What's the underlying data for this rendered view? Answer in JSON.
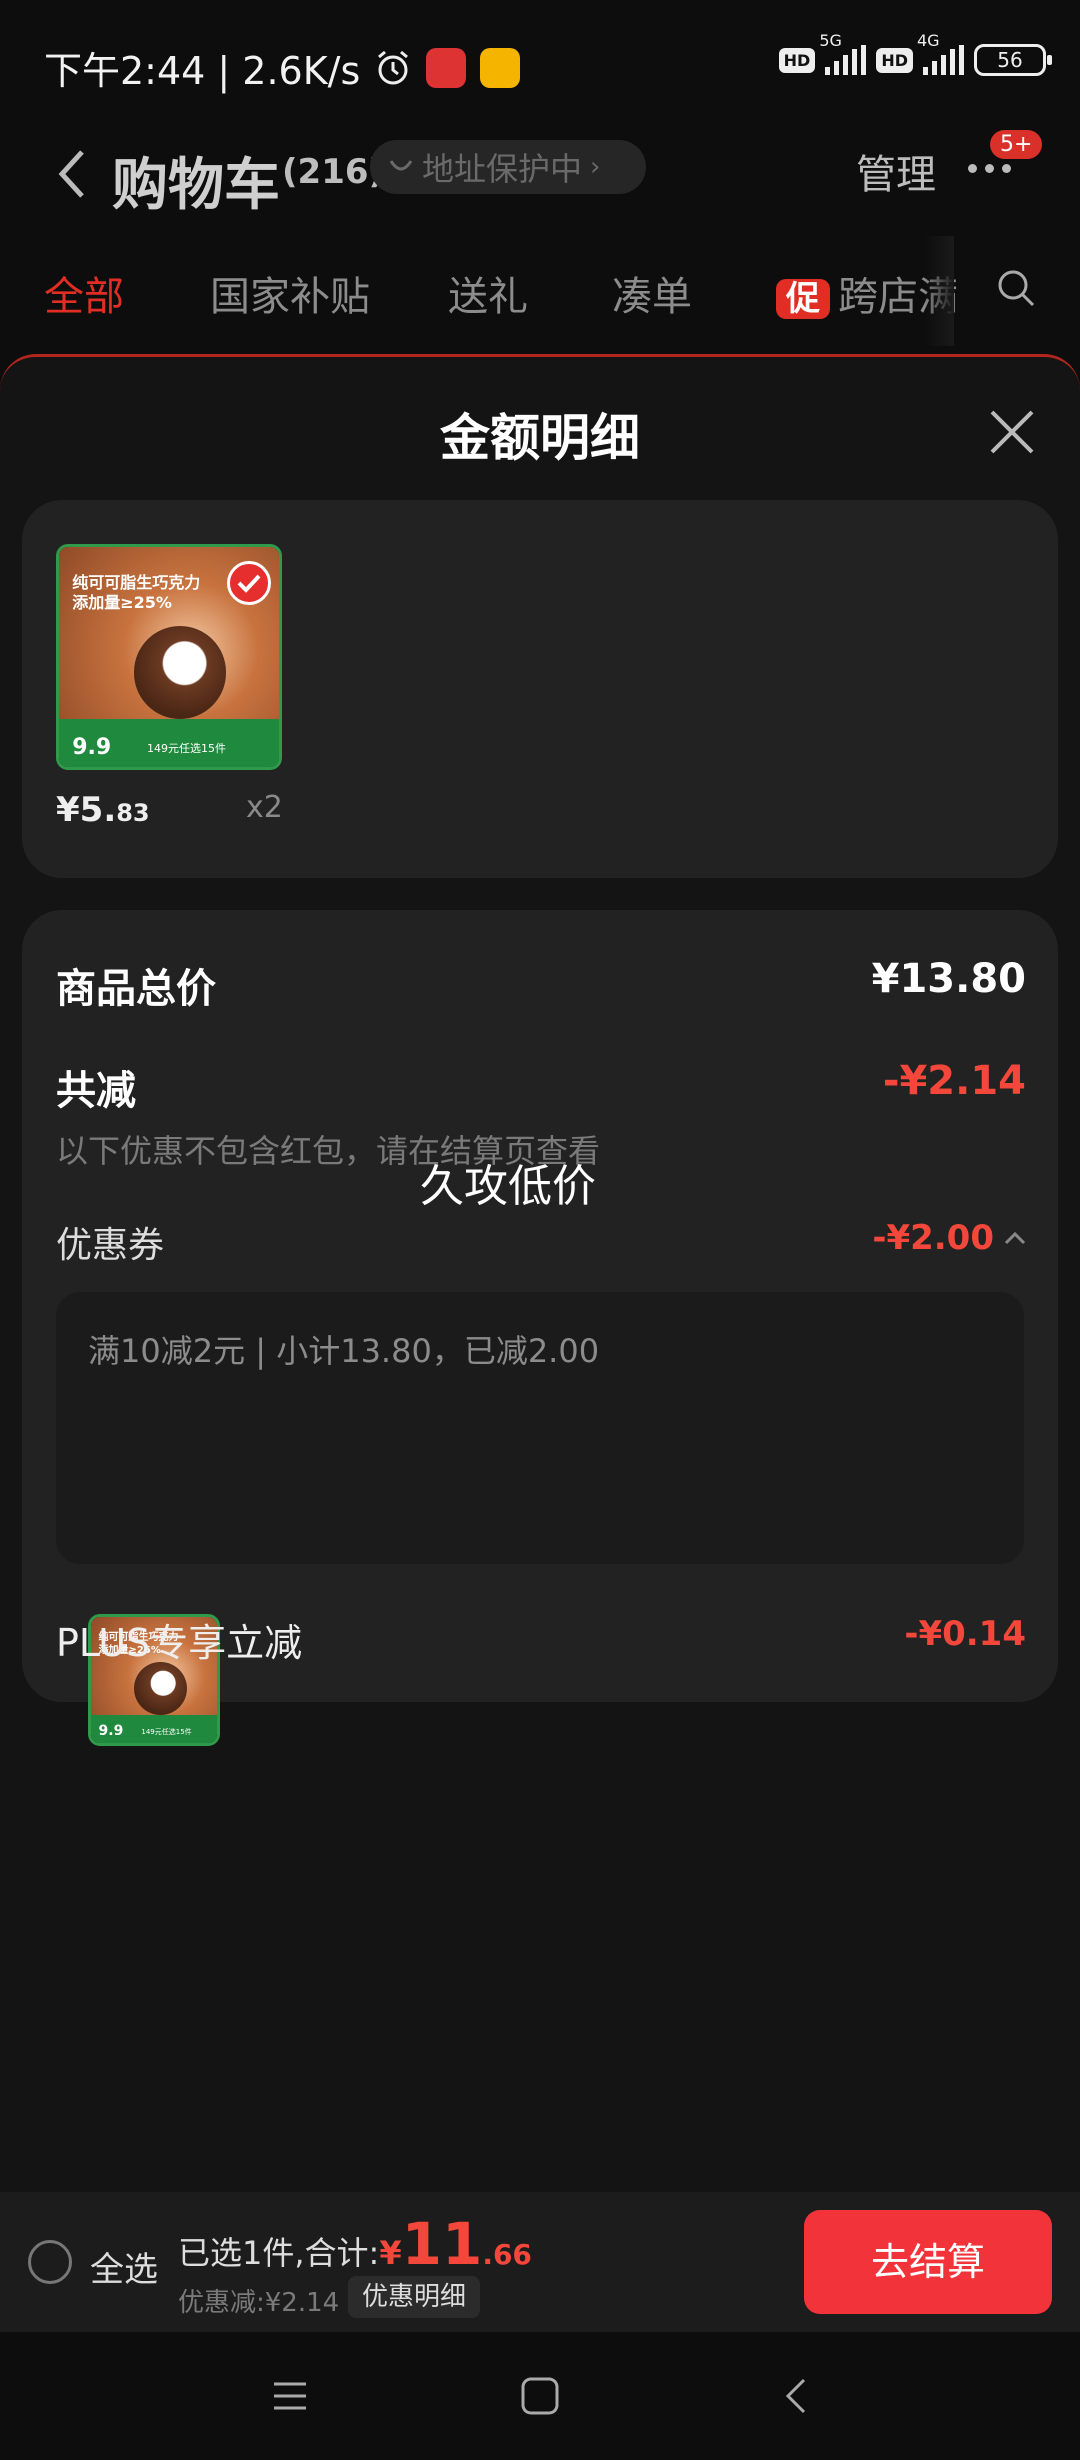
{
  "status_bar": {
    "time_speed": "下午2:44 | 2.6K/s",
    "net1": "5G",
    "net2": "4G",
    "hd": "HD",
    "battery": "56"
  },
  "header": {
    "title": "购物车",
    "count": "(216)",
    "address": "地址保护中",
    "manage": "管理",
    "badge": "5+"
  },
  "tabs": [
    {
      "label": "全部"
    },
    {
      "label": "国家补贴"
    },
    {
      "label": "送礼"
    },
    {
      "label": "凑单"
    },
    {
      "promo": "促",
      "label": "跨店满"
    }
  ],
  "sheet": {
    "title": "金额明细",
    "product": {
      "title_line1": "纯可可脂生巧克力",
      "title_line2": "添加量≥25%",
      "tag_price": "9.9",
      "tag_text": "149元任选15件",
      "unit_price_int": "¥5.",
      "unit_price_dec": "83",
      "qty": "x2"
    },
    "subtotal_label": "商品总价",
    "subtotal_value": "¥13.80",
    "discount_label": "共减",
    "discount_value": "-¥2.14",
    "note": "以下优惠不包含红包，请在结算页查看",
    "overlay_text": "久攻低价",
    "coupon_label": "优惠券",
    "coupon_value": "-¥2.00",
    "coupon_desc": "满10减2元 | 小计13.80，已减2.00",
    "plus_label": "PLUS专享立减",
    "plus_value": "-¥0.14"
  },
  "bottom_bar": {
    "select_all": "全选",
    "selected_text": "已选1件,合计:",
    "currency": "¥",
    "total_int": "11",
    "total_dec": ".66",
    "saved_text": "优惠减:¥2.14",
    "detail_label": "优惠明细",
    "checkout_label": "去结算"
  },
  "colors": {
    "accent_red": "#f2473a",
    "checkout_red": "#f2333a",
    "tab_active": "#e02e24"
  }
}
